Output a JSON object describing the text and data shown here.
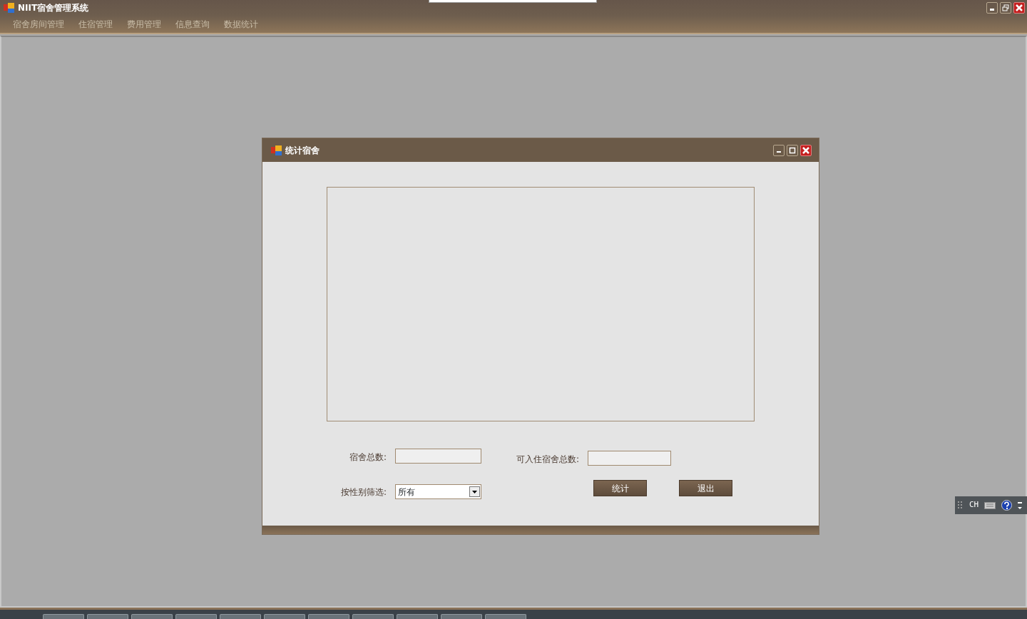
{
  "window": {
    "title": "NIIT宿舍管理系统"
  },
  "menu": [
    {
      "label": "宿舍房间管理"
    },
    {
      "label": "住宿管理"
    },
    {
      "label": "费用管理"
    },
    {
      "label": "信息查询"
    },
    {
      "label": "数据统计"
    }
  ],
  "dialog": {
    "title": "统计宿舍",
    "fields": [
      {
        "label": "宿舍总数:"
      },
      {
        "label": "可入住宿舍总数:"
      }
    ],
    "filter": {
      "label": "按性别筛选:",
      "value": "所有"
    },
    "buttons": [
      {
        "label": "统计"
      },
      {
        "label": "退出"
      }
    ]
  },
  "language_bar": {
    "language": "CH"
  }
}
